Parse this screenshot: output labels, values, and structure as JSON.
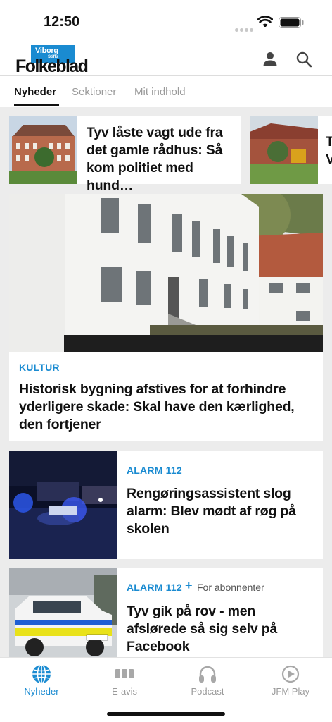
{
  "status": {
    "time": "12:50"
  },
  "header": {
    "logo": {
      "top": "Viborg",
      "sub": "Stifts",
      "main": "Folkeblad"
    }
  },
  "tabs": [
    {
      "label": "Nyheder",
      "active": true
    },
    {
      "label": "Sektioner",
      "active": false
    },
    {
      "label": "Mit indhold",
      "active": false
    }
  ],
  "carousel": [
    {
      "title": "Tyv låste vagt ude fra det gamle rådhus: Så kom politiet med hund…"
    },
    {
      "title": "T V"
    }
  ],
  "articles": [
    {
      "category": "KULTUR",
      "title": "Historisk bygning afstives for at forhindre yderligere skade: Skal have den kærlighed, den fortjener"
    },
    {
      "category": "ALARM 112",
      "title": "Rengøringsassistent slog alarm: Blev mødt af røg på skolen"
    },
    {
      "category": "ALARM 112",
      "premium_icon": "+",
      "premium_label": "For abonnenter",
      "title": "Tyv gik på rov - men afslørede så sig selv på Facebook"
    }
  ],
  "bottom_nav": [
    {
      "label": "Nyheder",
      "icon": "globe-icon",
      "active": true
    },
    {
      "label": "E-avis",
      "icon": "newspaper-icon",
      "active": false
    },
    {
      "label": "Podcast",
      "icon": "headphones-icon",
      "active": false
    },
    {
      "label": "JFM Play",
      "icon": "play-icon",
      "active": false
    }
  ],
  "colors": {
    "accent": "#1a8bd1",
    "text": "#111111",
    "muted": "#9a9a9a",
    "background": "#ececec"
  }
}
